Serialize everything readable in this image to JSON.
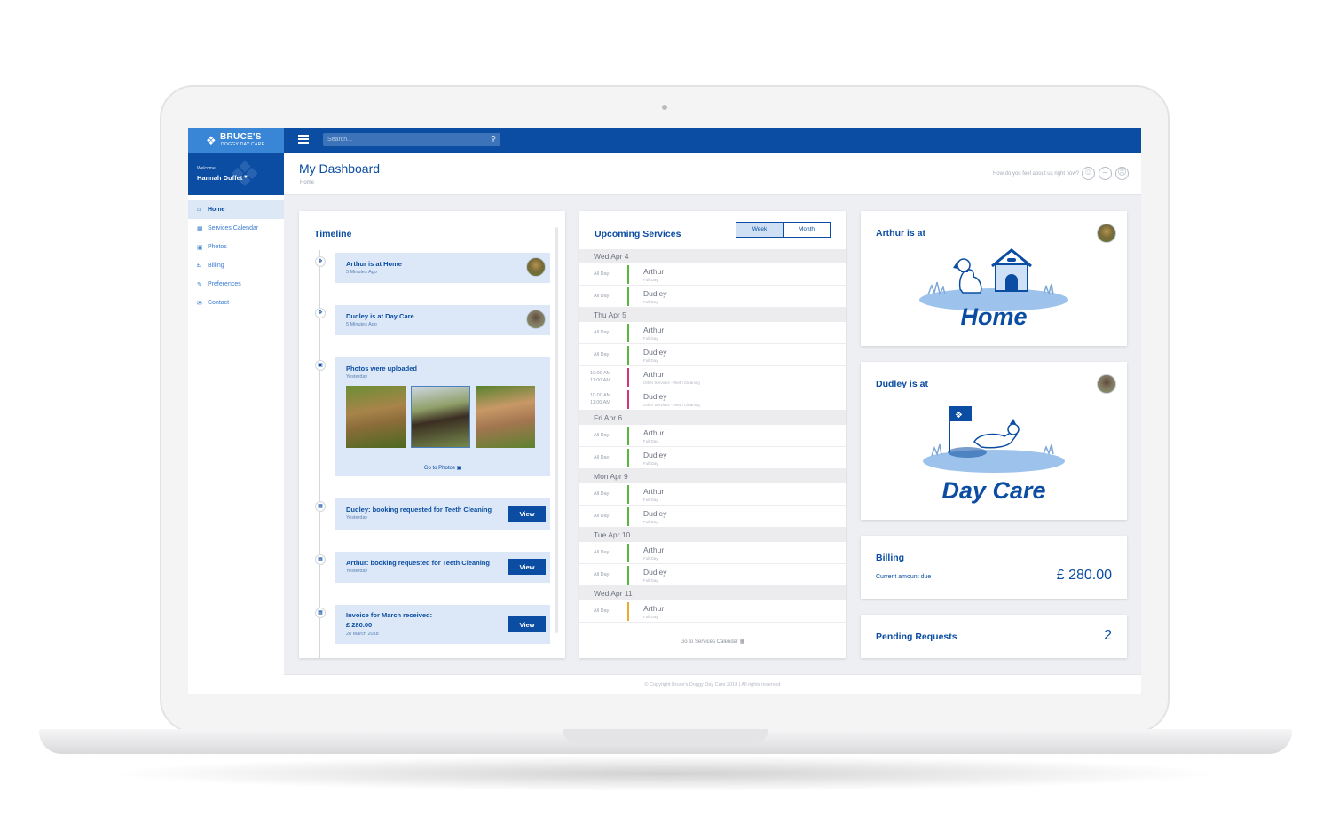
{
  "brand": {
    "title": "BRUCE'S",
    "subtitle": "DOGGY DAY CARE"
  },
  "search": {
    "placeholder": "Search..."
  },
  "user": {
    "welcome_label": "Welcome",
    "name": "Hannah Duffet"
  },
  "nav": {
    "items": [
      {
        "label": "Home",
        "icon": "home-icon",
        "active": true
      },
      {
        "label": "Services Calendar",
        "icon": "calendar-icon"
      },
      {
        "label": "Photos",
        "icon": "image-icon"
      },
      {
        "label": "Billing",
        "icon": "pound-icon"
      },
      {
        "label": "Preferences",
        "icon": "wrench-icon"
      },
      {
        "label": "Contact",
        "icon": "chat-icon"
      }
    ]
  },
  "header": {
    "title": "My Dashboard",
    "breadcrumb": "Home",
    "feedback_prompt": "How do you feel about us right now?"
  },
  "timeline": {
    "title": "Timeline",
    "items": [
      {
        "text": "Arthur is at Home",
        "sub": "5 Minutes Ago"
      },
      {
        "text": "Dudley is at Day Care",
        "sub": "5 Minutes Ago"
      },
      {
        "text": "Photos were uploaded",
        "sub": "Yesterday",
        "link": "Go to Photos"
      },
      {
        "text": "Dudley: booking requested for Teeth Cleaning",
        "sub": "Yesterday",
        "button": "View"
      },
      {
        "text": "Arthur: booking requested for Teeth Cleaning",
        "sub": "Yesterday",
        "button": "View"
      },
      {
        "text": "Invoice for March received:",
        "text2": "£ 280.00",
        "sub": "28 March 2018",
        "button": "View"
      }
    ]
  },
  "services": {
    "title": "Upcoming Services",
    "toggle": {
      "week": "Week",
      "month": "Month",
      "selected": "Week"
    },
    "days": [
      {
        "day": "Wed  Apr  4",
        "rows": [
          {
            "time": "All Day",
            "name": "Arthur",
            "type": "Full Day",
            "color": "#57b83d"
          },
          {
            "time": "All Day",
            "name": "Dudley",
            "type": "Full Day",
            "color": "#57b83d"
          }
        ]
      },
      {
        "day": "Thu  Apr  5",
        "rows": [
          {
            "time": "All Day",
            "name": "Arthur",
            "type": "Full Day",
            "color": "#57b83d"
          },
          {
            "time": "All Day",
            "name": "Dudley",
            "type": "Full Day",
            "color": "#57b83d"
          },
          {
            "time": "10:00 AM",
            "time2": "11:00 AM",
            "name": "Arthur",
            "type": "Other Services - Teeth Cleaning",
            "color": "#d6347a"
          },
          {
            "time": "10:00 AM",
            "time2": "11:00 AM",
            "name": "Dudley",
            "type": "Other Services - Teeth Cleaning",
            "color": "#d6347a"
          }
        ]
      },
      {
        "day": "Fri  Apr  6",
        "rows": [
          {
            "time": "All Day",
            "name": "Arthur",
            "type": "Full Day",
            "color": "#57b83d"
          },
          {
            "time": "All Day",
            "name": "Dudley",
            "type": "Full Day",
            "color": "#57b83d"
          }
        ]
      },
      {
        "day": "Mon  Apr  9",
        "rows": [
          {
            "time": "All Day",
            "name": "Arthur",
            "type": "Full Day",
            "color": "#57b83d"
          },
          {
            "time": "All Day",
            "name": "Dudley",
            "type": "Full Day",
            "color": "#57b83d"
          }
        ]
      },
      {
        "day": "Tue  Apr  10",
        "rows": [
          {
            "time": "All Day",
            "name": "Arthur",
            "type": "Full Day",
            "color": "#57b83d"
          },
          {
            "time": "All Day",
            "name": "Dudley",
            "type": "Full Day",
            "color": "#57b83d"
          }
        ]
      },
      {
        "day": "Wed  Apr  11",
        "rows": [
          {
            "time": "All Day",
            "name": "Arthur",
            "type": "Full Day",
            "color": "#f0a92f"
          }
        ]
      }
    ],
    "calendar_link": "Go to Services Calendar"
  },
  "status": {
    "arthur": {
      "title": "Arthur is at",
      "label": "Home"
    },
    "dudley": {
      "title": "Dudley is at",
      "label": "Day Care"
    }
  },
  "billing": {
    "title": "Billing",
    "subtitle": "Current amount due",
    "amount": "£ 280.00"
  },
  "pending": {
    "title": "Pending Requests",
    "count": "2"
  },
  "footer": {
    "text": "© Copyright Bruce's Doggy Day Care 2018  |  All rights reserved"
  },
  "colors": {
    "primary": "#0b4da2",
    "accent": "#3a86d6",
    "full_day": "#57b83d",
    "other_service": "#d6347a",
    "pending": "#f0a92f"
  }
}
